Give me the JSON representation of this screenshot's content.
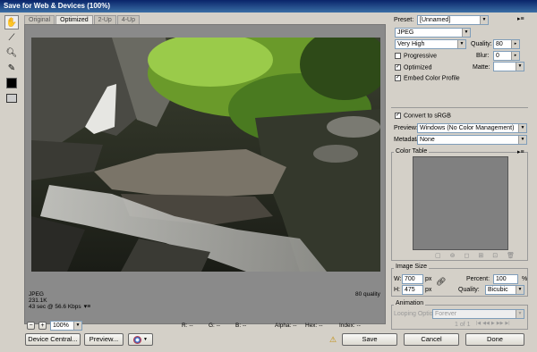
{
  "window": {
    "title": "Save for Web & Devices (100%)"
  },
  "tabs": [
    "Original",
    "Optimized",
    "2-Up",
    "4-Up"
  ],
  "active_tab": "Optimized",
  "tools": [
    "hand-icon",
    "slice-select-icon",
    "zoom-icon",
    "eyedropper-icon",
    "color-swatch-icon",
    "toggle-slices-icon"
  ],
  "preview": {
    "format": "JPEG",
    "size": "231.1K",
    "time": "43 sec @ 56.6 Kbps",
    "quality_label": "80 quality"
  },
  "bottom": {
    "zoom": "100%",
    "r_label": "R:",
    "g_label": "G:",
    "b_label": "B:",
    "alpha_label": "Alpha:",
    "hex_label": "Hex:",
    "index_label": "Index:",
    "r_val": "--",
    "g_val": "--",
    "b_val": "--",
    "alpha_val": "--",
    "hex_val": "--",
    "index_val": "--"
  },
  "buttons": {
    "device_central": "Device Central...",
    "preview": "Preview...",
    "save": "Save",
    "cancel": "Cancel",
    "done": "Done"
  },
  "settings": {
    "preset_label": "Preset:",
    "preset": "[Unnamed]",
    "format": "JPEG",
    "quality_preset": "Very High",
    "quality_label": "Quality:",
    "quality": "80",
    "progressive": "Progressive",
    "progressive_checked": false,
    "blur_label": "Blur:",
    "blur": "0",
    "optimized": "Optimized",
    "optimized_checked": true,
    "matte_label": "Matte:",
    "embed": "Embed Color Profile",
    "embed_checked": true,
    "convert": "Convert to sRGB",
    "convert_checked": true,
    "preview_label": "Preview:",
    "preview_value": "Windows (No Color Management)",
    "metadata_label": "Metadata:",
    "metadata_value": "None"
  },
  "color_table": {
    "title": "Color Table"
  },
  "image_size": {
    "title": "Image Size",
    "w_label": "W:",
    "w": "700",
    "h_label": "H:",
    "h": "475",
    "unit": "px",
    "percent_label": "Percent:",
    "percent": "100",
    "percent_unit": "%",
    "quality_label": "Quality:",
    "quality": "Bicubic"
  },
  "animation": {
    "title": "Animation",
    "looping_label": "Looping Options:",
    "looping": "Forever",
    "frame": "1 of 1"
  },
  "colors": {
    "titlebar": "#0a246a",
    "panel": "#d4d0c8",
    "colortable": "#808080",
    "warn": "#e8b000"
  }
}
